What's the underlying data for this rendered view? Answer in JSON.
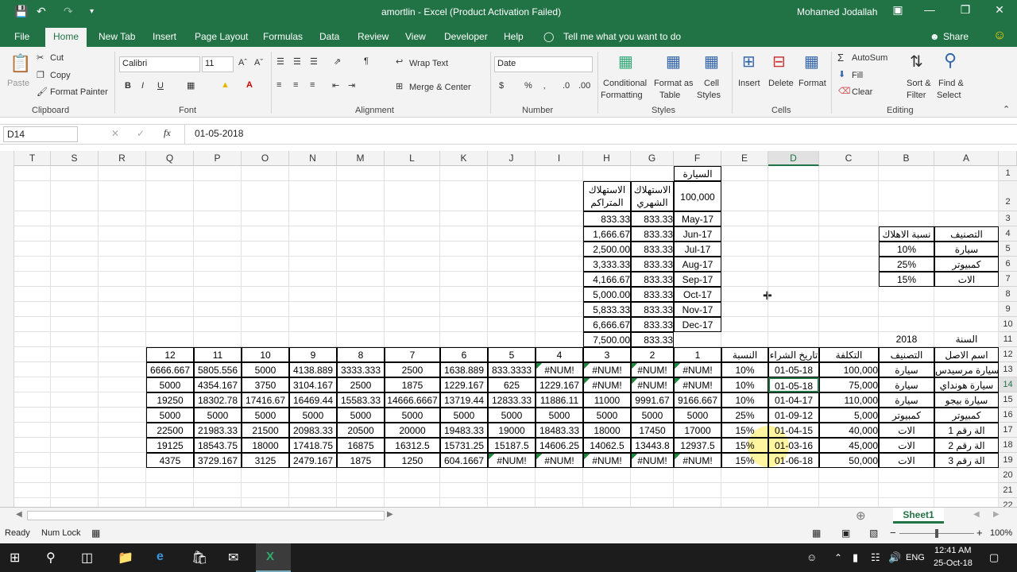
{
  "title": "amortlin  -  Excel (Product Activation Failed)",
  "user": "Mohamed Jodallah",
  "tabs": [
    "File",
    "Home",
    "New Tab",
    "Insert",
    "Page Layout",
    "Formulas",
    "Data",
    "Review",
    "View",
    "Developer",
    "Help"
  ],
  "tellme": "Tell me what you want to do",
  "share": "Share",
  "clipboard": {
    "paste": "Paste",
    "cut": "Cut",
    "copy": "Copy",
    "painter": "Format Painter",
    "group": "Clipboard"
  },
  "font": {
    "name": "Calibri",
    "size": "11",
    "group": "Font"
  },
  "alignment": {
    "wrap": "Wrap Text",
    "merge": "Merge & Center",
    "group": "Alignment"
  },
  "number": {
    "format": "Date",
    "group": "Number"
  },
  "styles": {
    "cond": "Conditional",
    "cond2": "Formatting",
    "fmt": "Format as",
    "fmt2": "Table",
    "cell": "Cell",
    "cell2": "Styles",
    "group": "Styles"
  },
  "cells": {
    "insert": "Insert",
    "delete": "Delete",
    "format": "Format",
    "group": "Cells"
  },
  "editing": {
    "autosum": "AutoSum",
    "fill": "Fill",
    "clear": "Clear",
    "sort": "Sort &",
    "sort2": "Filter",
    "find": "Find &",
    "find2": "Select",
    "group": "Editing"
  },
  "namebox": "D14",
  "formula": "01-05-2018",
  "columns": [
    "T",
    "S",
    "R",
    "Q",
    "P",
    "O",
    "N",
    "M",
    "L",
    "K",
    "J",
    "I",
    "H",
    "G",
    "F",
    "E",
    "D",
    "C",
    "B",
    "A"
  ],
  "rows": [
    "1",
    "2",
    "3",
    "4",
    "5",
    "6",
    "7",
    "8",
    "9",
    "10",
    "11",
    "12",
    "13",
    "14",
    "15",
    "16",
    "17",
    "18",
    "19",
    "20",
    "21",
    "22"
  ],
  "sheet": "Sheet1",
  "status": {
    "ready": "Ready",
    "numlock": "Num Lock",
    "zoom": "100%"
  },
  "clock": {
    "time": "12:41 AM",
    "date": "25-Oct-18",
    "lang": "ENG"
  },
  "topcells": {
    "F1": "السيارة",
    "F2": "100,000",
    "G2": "الاستهلاك الشهري",
    "H2": "الاستهلاك المتراكم",
    "months": [
      "May-17",
      "Jun-17",
      "Jul-17",
      "Aug-17",
      "Sep-17",
      "Oct-17",
      "Nov-17",
      "Dec-17"
    ],
    "monthly": [
      "833.33",
      "833.33",
      "833.33",
      "833.33",
      "833.33",
      "833.33",
      "833.33",
      "833.33",
      "833.33"
    ],
    "cumul": [
      "833.33",
      "1,666.67",
      "2,500.00",
      "3,333.33",
      "4,166.67",
      "5,000.00",
      "5,833.33",
      "6,666.67",
      "7,500.00"
    ]
  },
  "cat": {
    "h1": "التصنيف",
    "h2": "نسبة الاهلاك",
    "rows": [
      [
        "سيارة",
        "10%"
      ],
      [
        "كمبيوتر",
        "25%"
      ],
      [
        "الات",
        "15%"
      ]
    ]
  },
  "yearlabel": "السنة",
  "year": "2018",
  "main": {
    "header": [
      "اسم الاصل",
      "التصنيف",
      "التكلفة",
      "تاريخ الشراء",
      "النسبة",
      "1",
      "2",
      "3",
      "4",
      "5",
      "6",
      "7",
      "8",
      "9",
      "10",
      "11",
      "12"
    ],
    "rows": [
      [
        "سيارة مرسيدس",
        "سيارة",
        "100,000",
        "01-05-18",
        "10%",
        "#NUM!",
        "#NUM!",
        "#NUM!",
        "#NUM!",
        "833.3333",
        "1638.889",
        "2500",
        "3333.333",
        "4138.889",
        "5000",
        "5805.556",
        "6666.667"
      ],
      [
        "سيارة هونداي",
        "سيارة",
        "75,000",
        "01-05-18",
        "10%",
        "#NUM!",
        "#NUM!",
        "#NUM!",
        "1229.167",
        "625",
        "1229.167",
        "1875",
        "2500",
        "3104.167",
        "3750",
        "4354.167",
        "5000"
      ],
      [
        "سيارة بيجو",
        "سيارة",
        "110,000",
        "01-04-17",
        "10%",
        "9166.667",
        "9991.67",
        "11000",
        "11886.11",
        "12833.33",
        "13719.44",
        "14666.6667",
        "15583.33",
        "16469.44",
        "17416.67",
        "18302.78",
        "19250"
      ],
      [
        "كمبيوتر",
        "كمبيوتر",
        "5,000",
        "01-09-12",
        "25%",
        "5000",
        "5000",
        "5000",
        "5000",
        "5000",
        "5000",
        "5000",
        "5000",
        "5000",
        "5000",
        "5000",
        "5000"
      ],
      [
        "الة رقم 1",
        "الات",
        "40,000",
        "01-04-15",
        "15%",
        "17000",
        "17450",
        "18000",
        "18483.33",
        "19000",
        "19483.33",
        "20000",
        "20500",
        "20983.33",
        "21500",
        "21983.33",
        "22500"
      ],
      [
        "الة رقم 2",
        "الات",
        "45,000",
        "01-03-16",
        "15%",
        "12937.5",
        "13443.8",
        "14062.5",
        "14606.25",
        "15187.5",
        "15731.25",
        "16312.5",
        "16875",
        "17418.75",
        "18000",
        "18543.75",
        "19125"
      ],
      [
        "الة رقم 3",
        "الات",
        "50,000",
        "01-06-18",
        "15%",
        "#NUM!",
        "#NUM!",
        "#NUM!",
        "#NUM!",
        "#NUM!",
        "604.1667",
        "1250",
        "1875",
        "2479.167",
        "3125",
        "3729.167",
        "4375"
      ]
    ]
  }
}
